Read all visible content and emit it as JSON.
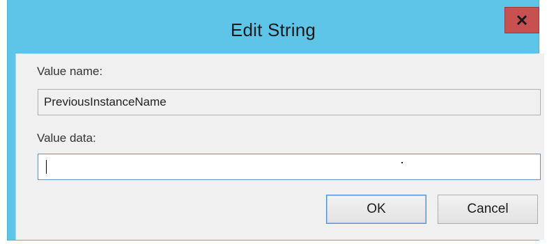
{
  "dialog": {
    "title": "Edit String",
    "close_icon": "close-icon",
    "value_name_label": "Value name:",
    "value_name": "PreviousInstanceName",
    "value_data_label": "Value data:",
    "value_data": "",
    "ok_label": "OK",
    "cancel_label": "Cancel"
  },
  "colors": {
    "titlebar": "#5fc5e8",
    "close_button": "#c75050",
    "client": "#f0f0f0"
  }
}
